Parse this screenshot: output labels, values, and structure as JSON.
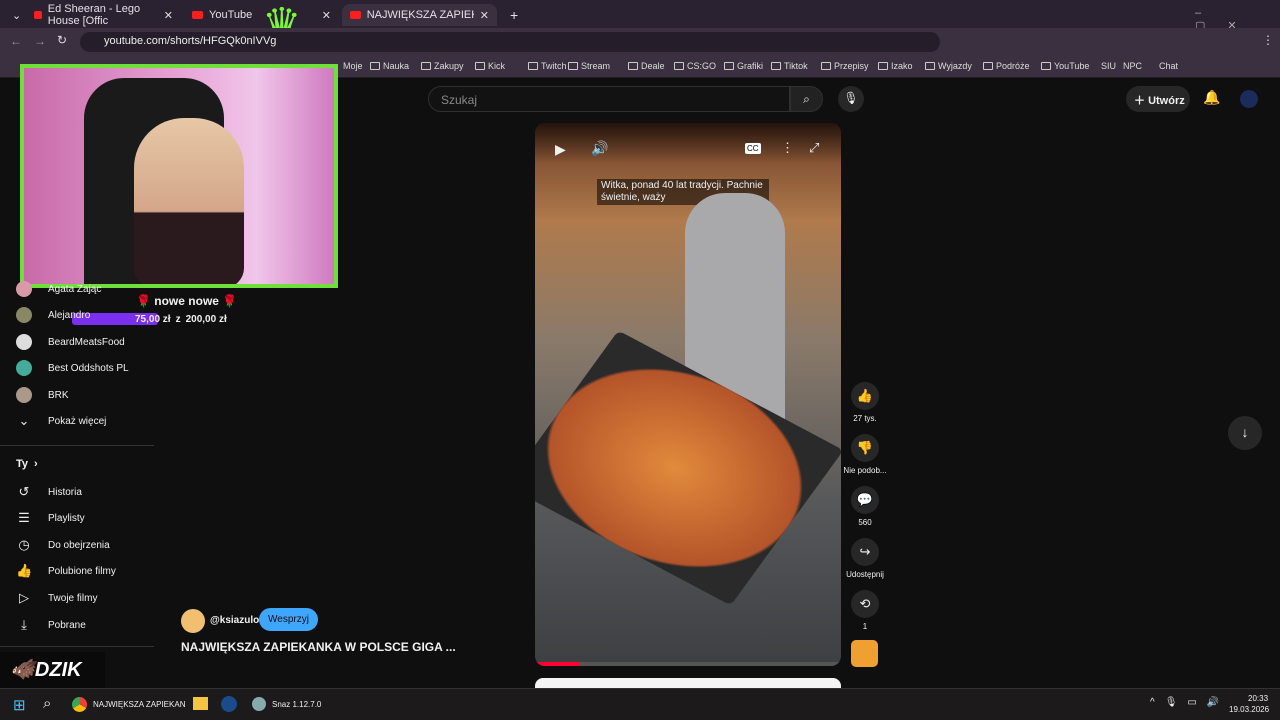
{
  "browser": {
    "tabs": [
      {
        "label": "Ed Sheeran - Lego House [Offic"
      },
      {
        "label": "YouTube"
      },
      {
        "label": "NAJWIĘKSZA ZAPIEKANKA W P"
      }
    ],
    "url": "youtube.com/shorts/HFGQk0nIVVg",
    "bookmarks": [
      "Moje",
      "Nauka",
      "Zakupy",
      "Kick",
      "Twitch",
      "Stream",
      "Deale",
      "CS:GO",
      "Grafiki",
      "Tiktok",
      "Przepisy",
      "Izako",
      "Wyjazdy",
      "Podróże",
      "YouTube",
      "SIU",
      "NPC",
      "Chat"
    ]
  },
  "overlay": {
    "goal_title": "🌹 nowe nowe 🌹",
    "goal_current": "75,00 zł",
    "goal_sep": "z",
    "goal_target": "200,00 zł",
    "goal_progress": 0.375,
    "logo": "DZIK"
  },
  "sidebar": {
    "subscriptions": [
      {
        "label": "Agata Zając"
      },
      {
        "label": "Alejandro"
      },
      {
        "label": "BeardMeatsFood"
      },
      {
        "label": "Best Oddshots PL"
      },
      {
        "label": "BRK"
      }
    ],
    "show_more": "Pokaż więcej",
    "you_label": "Ty",
    "you_items": [
      {
        "label": "Historia",
        "icon": "history-icon"
      },
      {
        "label": "Playlisty",
        "icon": "playlist-icon"
      },
      {
        "label": "Do obejrzenia",
        "icon": "clock-icon"
      },
      {
        "label": "Polubione filmy",
        "icon": "thumbs-up-icon"
      },
      {
        "label": "Twoje filmy",
        "icon": "video-icon"
      },
      {
        "label": "Pobrane",
        "icon": "download-icon"
      }
    ]
  },
  "header": {
    "search_placeholder": "Szukaj",
    "create_label": "Utwórz"
  },
  "short": {
    "caption": "Witka, ponad 40 lat tradycji. Pachnie świetnie, waży",
    "channel": "@ksiazulo",
    "support_label": "Wesprzyj",
    "title": "NAJWIĘKSZA ZAPIEKANKA W POLSCE GIGA ...",
    "likes": "27 tys.",
    "dislike_label": "Nie podob...",
    "comments": "560",
    "share_label": "Udostępnij",
    "remix_count": "1"
  },
  "taskbar": {
    "chrome_label": "NAJWIĘKSZA ZAPIEKAN",
    "app_label": "Snaz 1.12.7.0",
    "time": "20:33",
    "date": "19.03.2026"
  },
  "colors": {
    "accent_green": "#6fe03a",
    "yt_red": "#ff0033",
    "support_blue": "#3ea6ff",
    "goal_purple": "#7b2ff0"
  }
}
